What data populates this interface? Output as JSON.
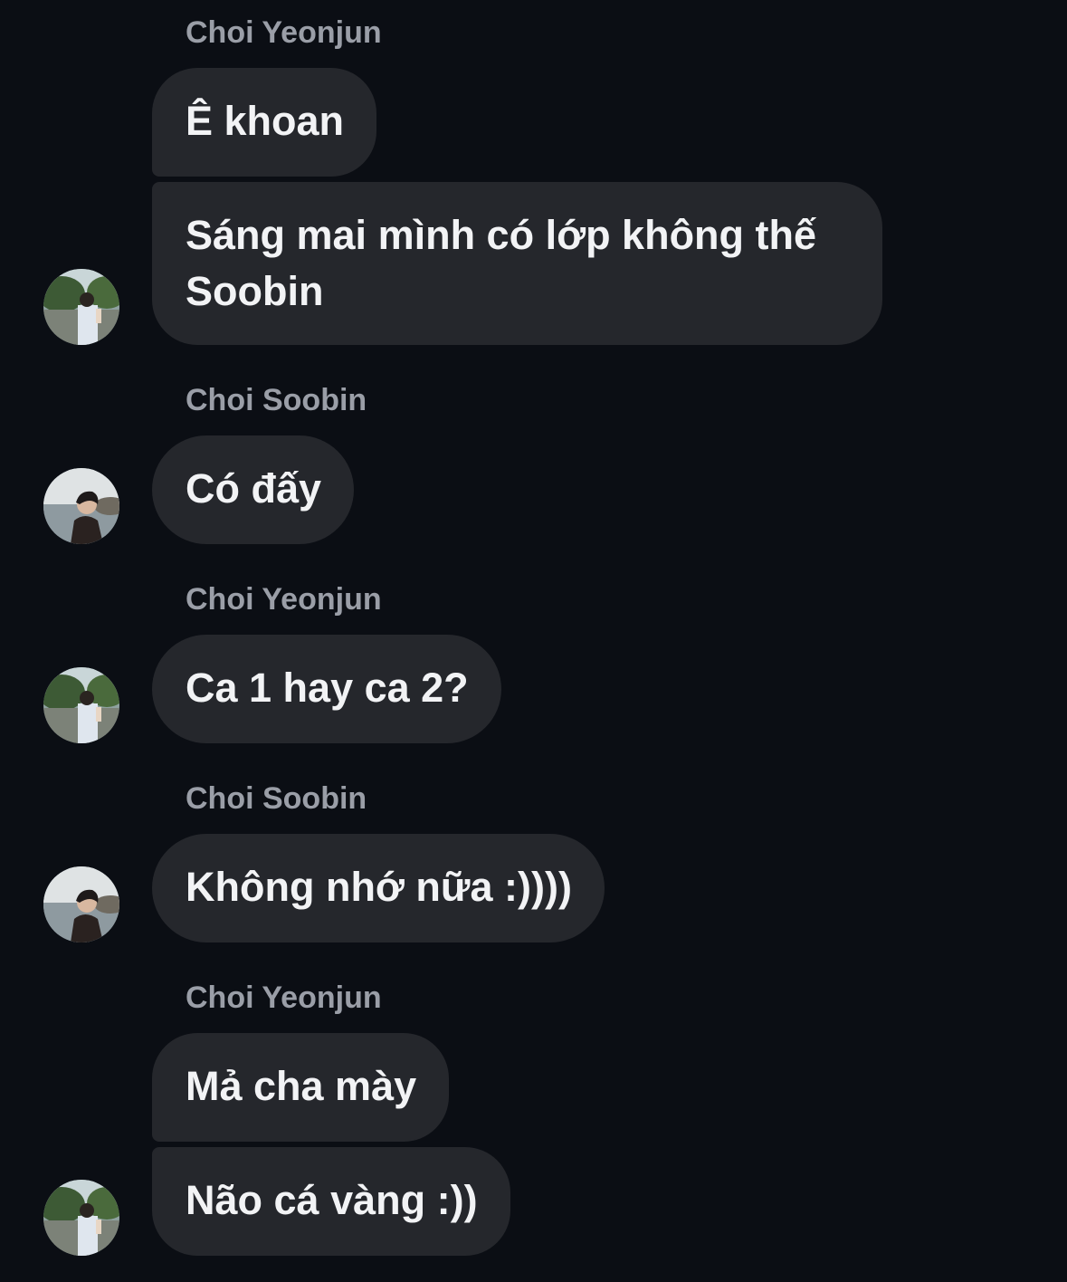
{
  "messages": [
    {
      "sender": "Choi Yeonjun",
      "bubbles": [
        "Ê khoan",
        "Sáng mai mình có lớp không thế Soobin"
      ],
      "avatar": "yeonjun-avatar"
    },
    {
      "sender": "Choi Soobin",
      "bubbles": [
        "Có đấy"
      ],
      "avatar": "soobin-avatar"
    },
    {
      "sender": "Choi Yeonjun",
      "bubbles": [
        "Ca 1 hay ca 2?"
      ],
      "avatar": "yeonjun-avatar"
    },
    {
      "sender": "Choi Soobin",
      "bubbles": [
        "Không nhớ nữa :))))"
      ],
      "avatar": "soobin-avatar"
    },
    {
      "sender": "Choi Yeonjun",
      "bubbles": [
        "Mả cha mày",
        "Não cá vàng :))"
      ],
      "avatar": "yeonjun-avatar"
    }
  ],
  "colors": {
    "background": "#0b0e14",
    "bubble": "#25272c",
    "sender_text": "#9a9ea7",
    "message_text": "#f2f3f5"
  }
}
